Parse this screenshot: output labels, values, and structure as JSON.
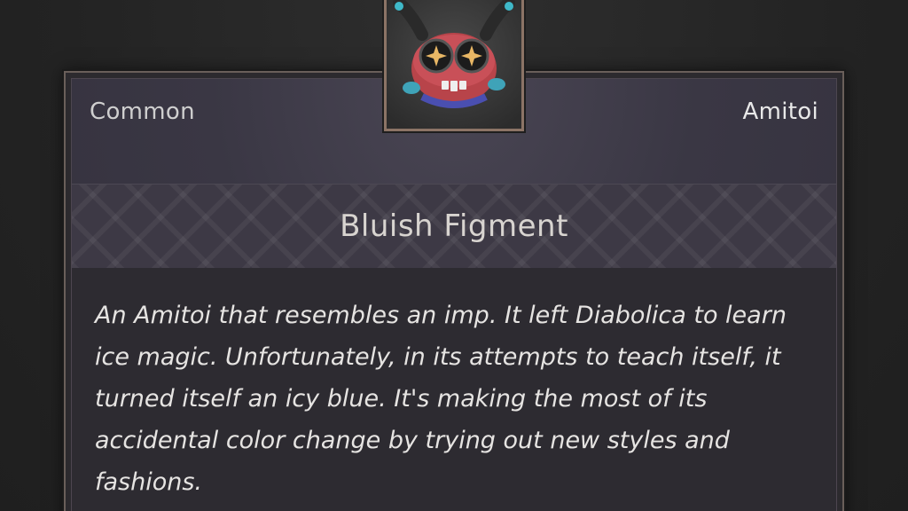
{
  "card": {
    "rarity": "Common",
    "category": "Amitoi",
    "name": "Bluish Figment",
    "description": "An Amitoi that resembles an imp. It left Diabolica to learn ice magic. Unfortunately, in its attempts to teach itself, it turned itself an icy blue. It's making the most of its accidental color change by trying out new styles and fashions."
  },
  "portrait": {
    "icon": "imp-creature-icon"
  },
  "colors": {
    "frame_border": "#8c7466",
    "panel_bg": "#3a3744",
    "description_bg": "#2d2b31",
    "text_primary": "#e6e4e2"
  }
}
